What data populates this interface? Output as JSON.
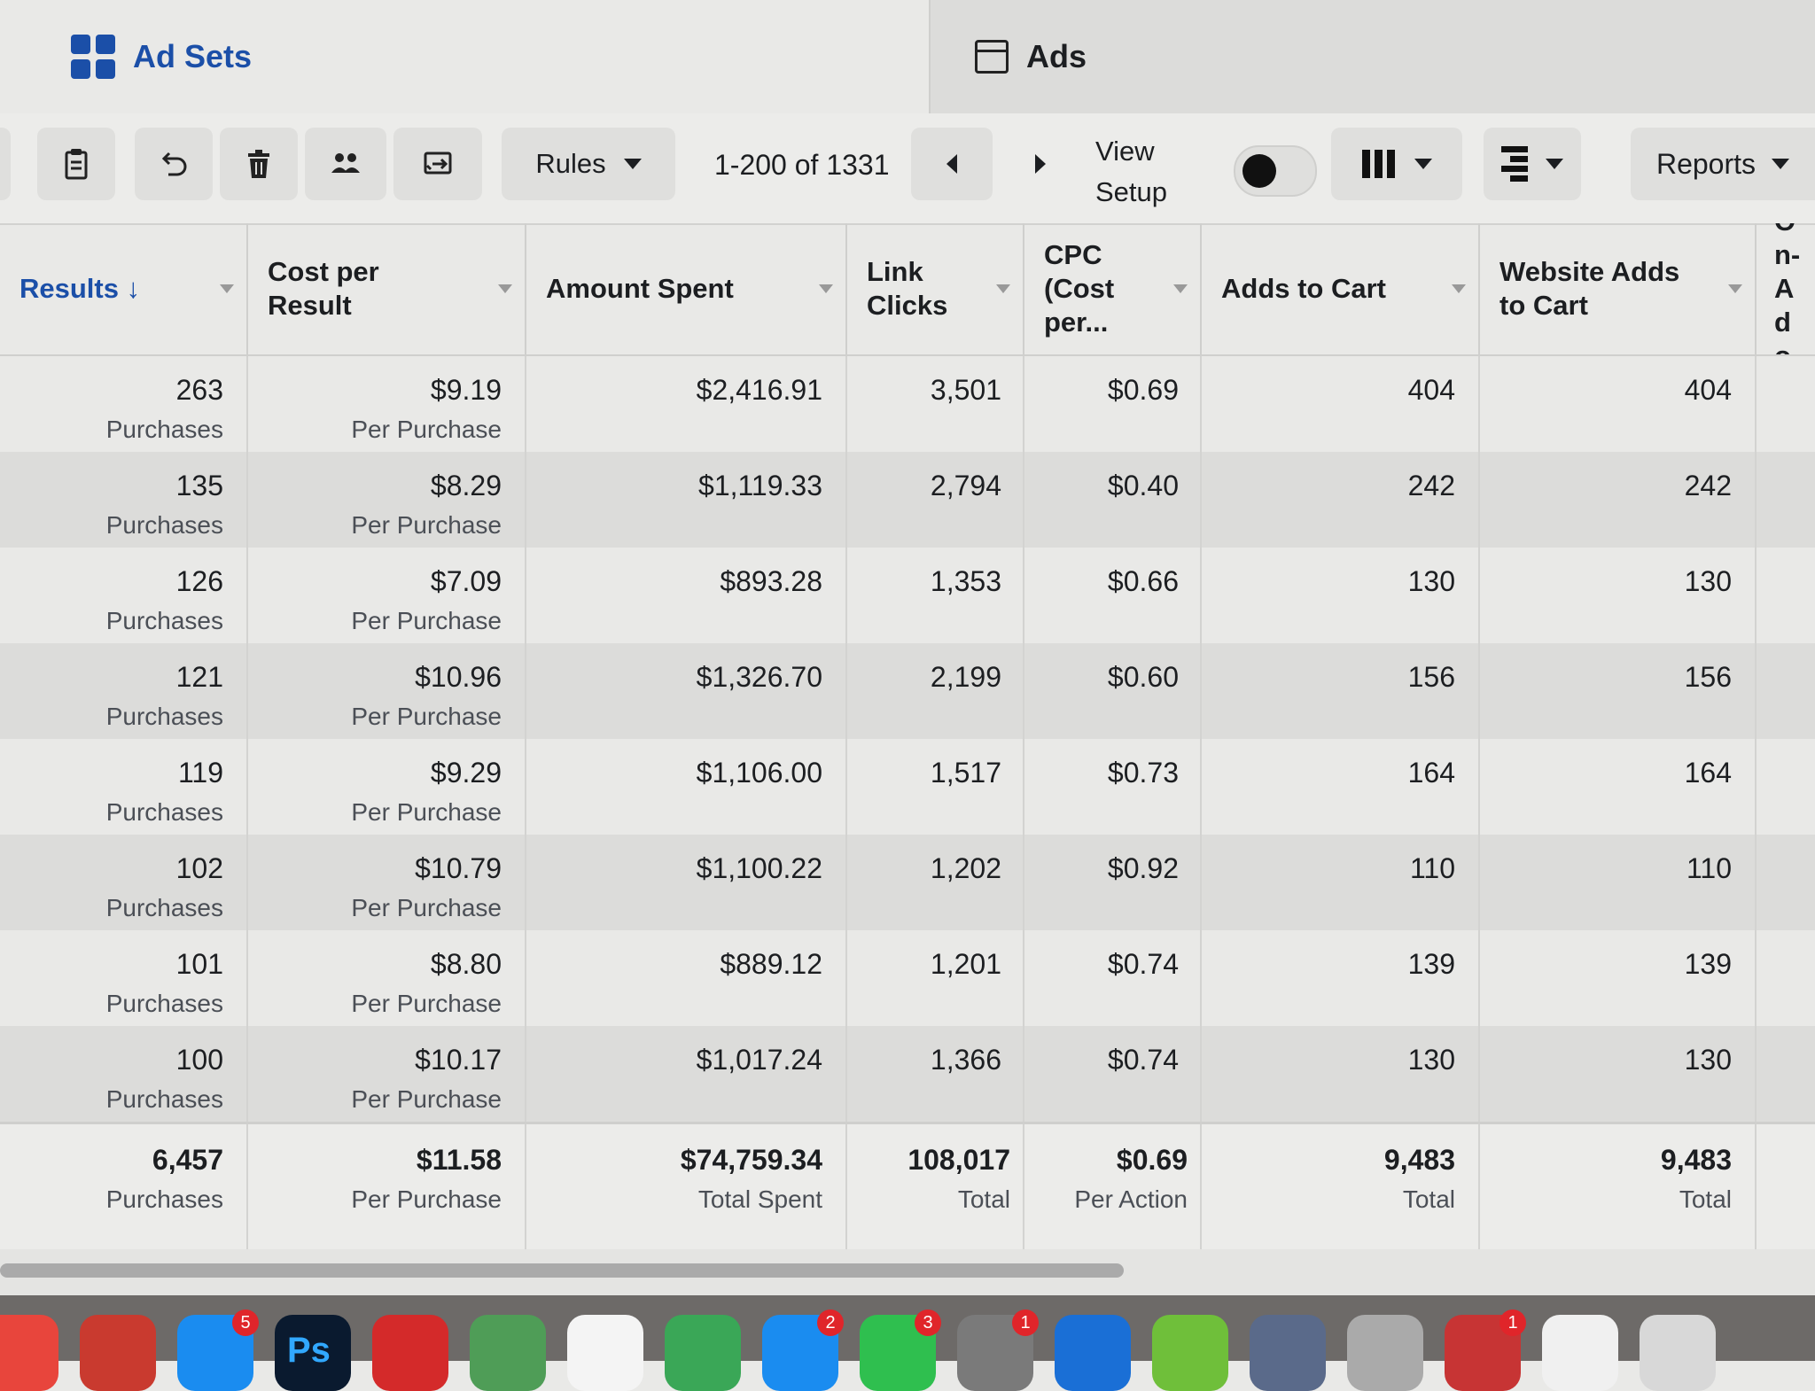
{
  "tabs": {
    "adsets": {
      "label": "Ad Sets",
      "icon": "grid-icon"
    },
    "ads": {
      "label": "Ads",
      "icon": "ad-preview-icon"
    }
  },
  "toolbar": {
    "icons": [
      "clipboard-icon",
      "undo-icon",
      "trash-icon",
      "audience-icon",
      "export-icon"
    ],
    "rules_label": "Rules",
    "pagination": "1-200 of 1331",
    "view_setup_line1": "View",
    "view_setup_line2": "Setup",
    "reports_label": "Reports"
  },
  "table": {
    "headers": [
      {
        "label": "Results ↓",
        "sorted": true
      },
      {
        "label": "Cost per Result"
      },
      {
        "label": "Amount Spent"
      },
      {
        "label": "Link Clicks"
      },
      {
        "label": "CPC (Cost per..."
      },
      {
        "label": "Adds to Cart"
      },
      {
        "label": "Website Adds to Cart"
      },
      {
        "label": "On-Ado"
      }
    ],
    "rows": [
      {
        "results": "263",
        "results_sub": "Purchases",
        "cpr": "$9.19",
        "cpr_sub": "Per Purchase",
        "spent": "$2,416.91",
        "clicks": "3,501",
        "cpc": "$0.69",
        "atc": "404",
        "wat": "404"
      },
      {
        "results": "135",
        "results_sub": "Purchases",
        "cpr": "$8.29",
        "cpr_sub": "Per Purchase",
        "spent": "$1,119.33",
        "clicks": "2,794",
        "cpc": "$0.40",
        "atc": "242",
        "wat": "242"
      },
      {
        "results": "126",
        "results_sub": "Purchases",
        "cpr": "$7.09",
        "cpr_sub": "Per Purchase",
        "spent": "$893.28",
        "clicks": "1,353",
        "cpc": "$0.66",
        "atc": "130",
        "wat": "130"
      },
      {
        "results": "121",
        "results_sub": "Purchases",
        "cpr": "$10.96",
        "cpr_sub": "Per Purchase",
        "spent": "$1,326.70",
        "clicks": "2,199",
        "cpc": "$0.60",
        "atc": "156",
        "wat": "156"
      },
      {
        "results": "119",
        "results_sub": "Purchases",
        "cpr": "$9.29",
        "cpr_sub": "Per Purchase",
        "spent": "$1,106.00",
        "clicks": "1,517",
        "cpc": "$0.73",
        "atc": "164",
        "wat": "164"
      },
      {
        "results": "102",
        "results_sub": "Purchases",
        "cpr": "$10.79",
        "cpr_sub": "Per Purchase",
        "spent": "$1,100.22",
        "clicks": "1,202",
        "cpc": "$0.92",
        "atc": "110",
        "wat": "110"
      },
      {
        "results": "101",
        "results_sub": "Purchases",
        "cpr": "$8.80",
        "cpr_sub": "Per Purchase",
        "spent": "$889.12",
        "clicks": "1,201",
        "cpc": "$0.74",
        "atc": "139",
        "wat": "139"
      },
      {
        "results": "100",
        "results_sub": "Purchases",
        "cpr": "$10.17",
        "cpr_sub": "Per Purchase",
        "spent": "$1,017.24",
        "clicks": "1,366",
        "cpc": "$0.74",
        "atc": "130",
        "wat": "130"
      }
    ],
    "summary": {
      "results": "6,457",
      "results_sub": "Purchases",
      "cpr": "$11.58",
      "cpr_sub": "Per Purchase",
      "spent": "$74,759.34",
      "spent_sub": "Total Spent",
      "clicks": "108,017",
      "clicks_sub": "Total",
      "cpc": "$0.69",
      "cpc_sub": "Per Action",
      "atc": "9,483",
      "atc_sub": "Total",
      "wat": "9,483",
      "wat_sub": "Total"
    }
  },
  "dock": {
    "apps": [
      {
        "name": "chrome-icon"
      },
      {
        "name": "reeder-icon"
      },
      {
        "name": "app-store-icon",
        "badge": "5"
      },
      {
        "name": "photoshop-icon",
        "text": "Ps"
      },
      {
        "name": "creative-cloud-icon"
      },
      {
        "name": "maps-icon"
      },
      {
        "name": "photos-icon"
      },
      {
        "name": "numbers-icon"
      },
      {
        "name": "messages-icon",
        "badge": "2"
      },
      {
        "name": "facetime-icon",
        "badge": "3"
      },
      {
        "name": "system-preferences-icon",
        "badge": "1"
      },
      {
        "name": "safari-icon"
      },
      {
        "name": "grapher-icon"
      },
      {
        "name": "preview-icon"
      },
      {
        "name": "script-editor-icon"
      },
      {
        "name": "installer-icon",
        "badge": "1"
      },
      {
        "name": "textedit-icon"
      },
      {
        "name": "keyboard-viewer-icon"
      }
    ],
    "colors": [
      "#e8453c",
      "#c93a2f",
      "#1a8cf0",
      "#0a1a2f",
      "#d42a2a",
      "#4f9d57",
      "#f4f4f4",
      "#3aa757",
      "#1a8cf0",
      "#2fbf4f",
      "#7a7a7a",
      "#1a6fd6",
      "#6fbf3a",
      "#5a6a8a",
      "#aaaaaa",
      "#c73434",
      "#f0f0f0",
      "#d8d8d8"
    ]
  }
}
